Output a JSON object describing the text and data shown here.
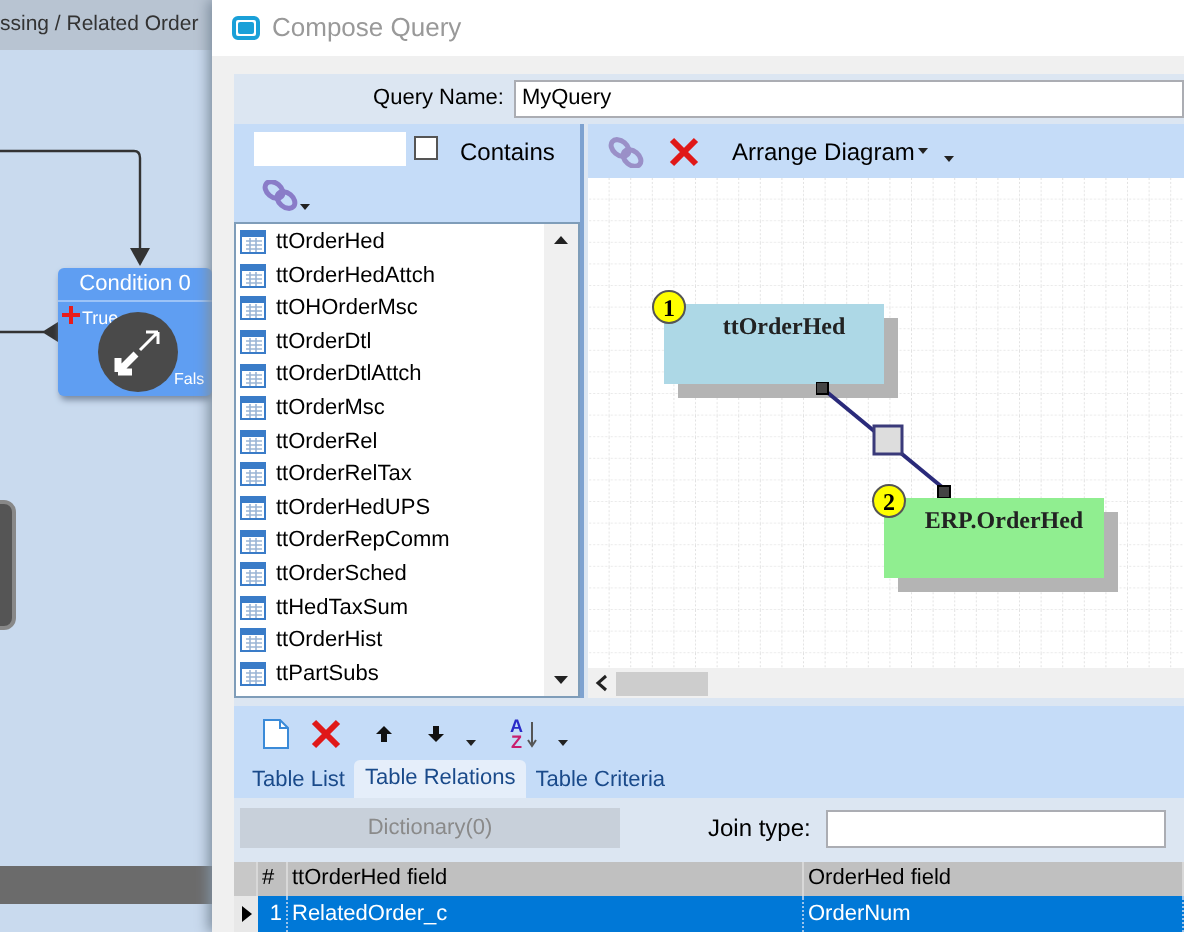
{
  "background": {
    "breadcrumb": "ssing / Related Order",
    "node": {
      "title": "Condition 0",
      "true_label": "True",
      "false_label": "Fals"
    }
  },
  "window": {
    "title": "Compose Query"
  },
  "query_name": {
    "label": "Query Name:",
    "value": "MyQuery"
  },
  "table_filter": {
    "contains_label": "Contains",
    "contains_checked": false
  },
  "tables": [
    "ttOrderHed",
    "ttOrderHedAttch",
    "ttOHOrderMsc",
    "ttOrderDtl",
    "ttOrderDtlAttch",
    "ttOrderMsc",
    "ttOrderRel",
    "ttOrderRelTax",
    "ttOrderHedUPS",
    "ttOrderRepComm",
    "ttOrderSched",
    "ttHedTaxSum",
    "ttOrderHist",
    "ttPartSubs"
  ],
  "diagram_toolbar": {
    "arrange_label": "Arrange Diagram"
  },
  "diagram_nodes": [
    {
      "number": "1",
      "name": "ttOrderHed",
      "color": "#add8e6"
    },
    {
      "number": "2",
      "name": "ERP.OrderHed",
      "color": "#90ee90"
    }
  ],
  "sort_button": {
    "top": "A",
    "bottom": "Z"
  },
  "tabs": [
    {
      "label": "Table List",
      "selected": false
    },
    {
      "label": "Table Relations",
      "selected": true
    },
    {
      "label": "Table Criteria",
      "selected": false
    }
  ],
  "dictionary_button": {
    "label": "Dictionary(0)",
    "disabled": true
  },
  "join_type": {
    "label": "Join type:"
  },
  "relations_grid": {
    "columns": [
      "#",
      "ttOrderHed field",
      "OrderHed field"
    ],
    "rows": [
      {
        "cells": [
          "1",
          "RelatedOrder_c",
          "OrderNum"
        ],
        "selected": true
      }
    ]
  }
}
